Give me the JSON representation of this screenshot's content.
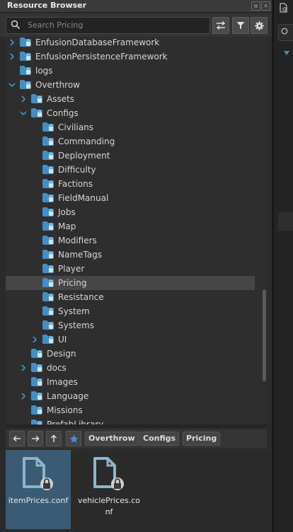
{
  "window": {
    "title": "Resource Browser"
  },
  "search": {
    "placeholder": "Search Pricing"
  },
  "tree": [
    {
      "label": "EnfusionDatabaseFramework",
      "depth": 0,
      "expander": "collapsed"
    },
    {
      "label": "EnfusionPersistenceFramework",
      "depth": 0,
      "expander": "collapsed"
    },
    {
      "label": "logs",
      "depth": 0,
      "expander": "none"
    },
    {
      "label": "Overthrow",
      "depth": 0,
      "expander": "expanded"
    },
    {
      "label": "Assets",
      "depth": 1,
      "expander": "collapsed"
    },
    {
      "label": "Configs",
      "depth": 1,
      "expander": "expanded"
    },
    {
      "label": "Civilians",
      "depth": 2,
      "expander": "none"
    },
    {
      "label": "Commanding",
      "depth": 2,
      "expander": "none"
    },
    {
      "label": "Deployment",
      "depth": 2,
      "expander": "none"
    },
    {
      "label": "Difficulty",
      "depth": 2,
      "expander": "none"
    },
    {
      "label": "Factions",
      "depth": 2,
      "expander": "none"
    },
    {
      "label": "FieldManual",
      "depth": 2,
      "expander": "none"
    },
    {
      "label": "Jobs",
      "depth": 2,
      "expander": "none"
    },
    {
      "label": "Map",
      "depth": 2,
      "expander": "none"
    },
    {
      "label": "Modifiers",
      "depth": 2,
      "expander": "none"
    },
    {
      "label": "NameTags",
      "depth": 2,
      "expander": "none"
    },
    {
      "label": "Player",
      "depth": 2,
      "expander": "none"
    },
    {
      "label": "Pricing",
      "depth": 2,
      "expander": "none",
      "selected": true
    },
    {
      "label": "Resistance",
      "depth": 2,
      "expander": "none"
    },
    {
      "label": "System",
      "depth": 2,
      "expander": "none"
    },
    {
      "label": "Systems",
      "depth": 2,
      "expander": "none"
    },
    {
      "label": "UI",
      "depth": 2,
      "expander": "collapsed"
    },
    {
      "label": "Design",
      "depth": 1,
      "expander": "none"
    },
    {
      "label": "docs",
      "depth": 1,
      "expander": "collapsed"
    },
    {
      "label": "Images",
      "depth": 1,
      "expander": "none"
    },
    {
      "label": "Language",
      "depth": 1,
      "expander": "collapsed"
    },
    {
      "label": "Missions",
      "depth": 1,
      "expander": "none"
    },
    {
      "label": "PrefabLibrary",
      "depth": 1,
      "expander": "none"
    }
  ],
  "breadcrumb": [
    "Overthrow",
    "Configs",
    "Pricing"
  ],
  "files": [
    {
      "name": "itemPrices.conf",
      "selected": true
    },
    {
      "name": "vehiclePrices.conf",
      "selected": false
    }
  ],
  "colors": {
    "folder": "#3f8fc9",
    "selection": "#474747",
    "file_selection": "#3b5a73",
    "star": "#4a90d9"
  }
}
